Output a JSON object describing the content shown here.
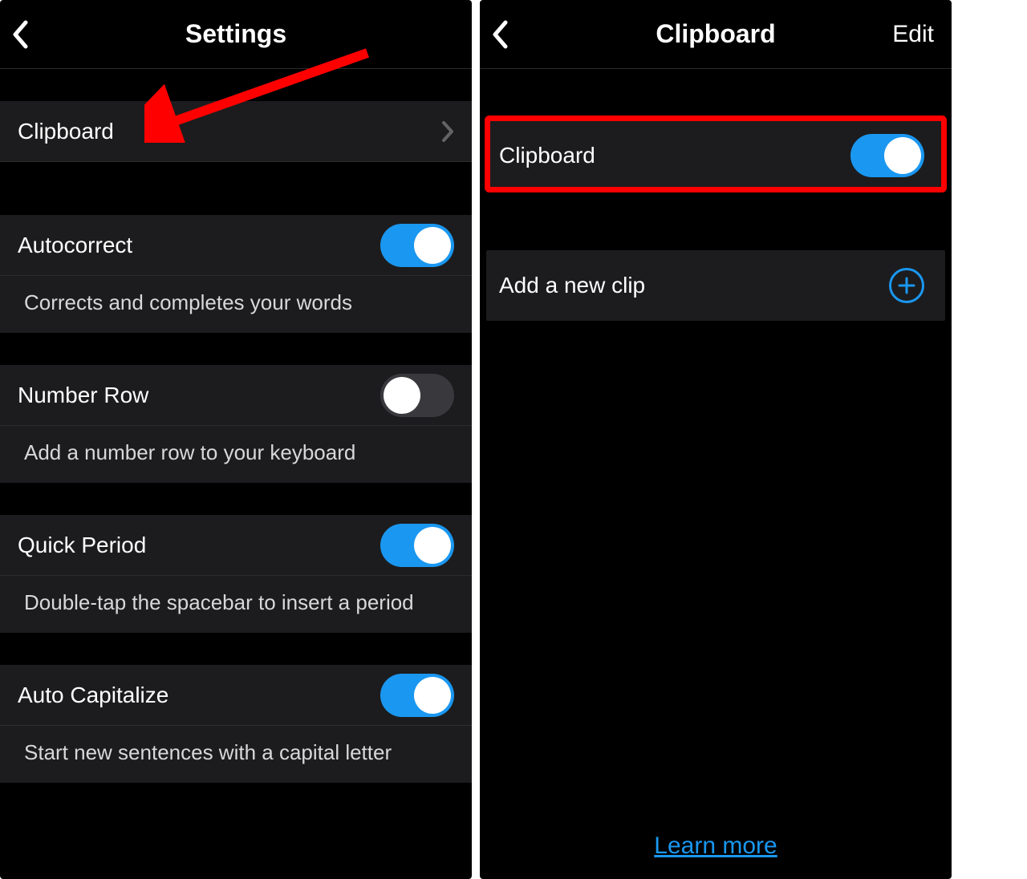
{
  "left": {
    "title": "Settings",
    "clipboard_label": "Clipboard",
    "items": [
      {
        "label": "Autocorrect",
        "desc": "Corrects and completes your words",
        "on": true
      },
      {
        "label": "Number Row",
        "desc": "Add a number row to your keyboard",
        "on": false
      },
      {
        "label": "Quick Period",
        "desc": "Double-tap the spacebar to insert a period",
        "on": true
      },
      {
        "label": "Auto Capitalize",
        "desc": "Start new sentences with a capital letter",
        "on": true
      }
    ]
  },
  "right": {
    "title": "Clipboard",
    "edit": "Edit",
    "clipboard_label": "Clipboard",
    "clipboard_on": true,
    "add_clip": "Add a new clip",
    "learn_more": "Learn more"
  }
}
